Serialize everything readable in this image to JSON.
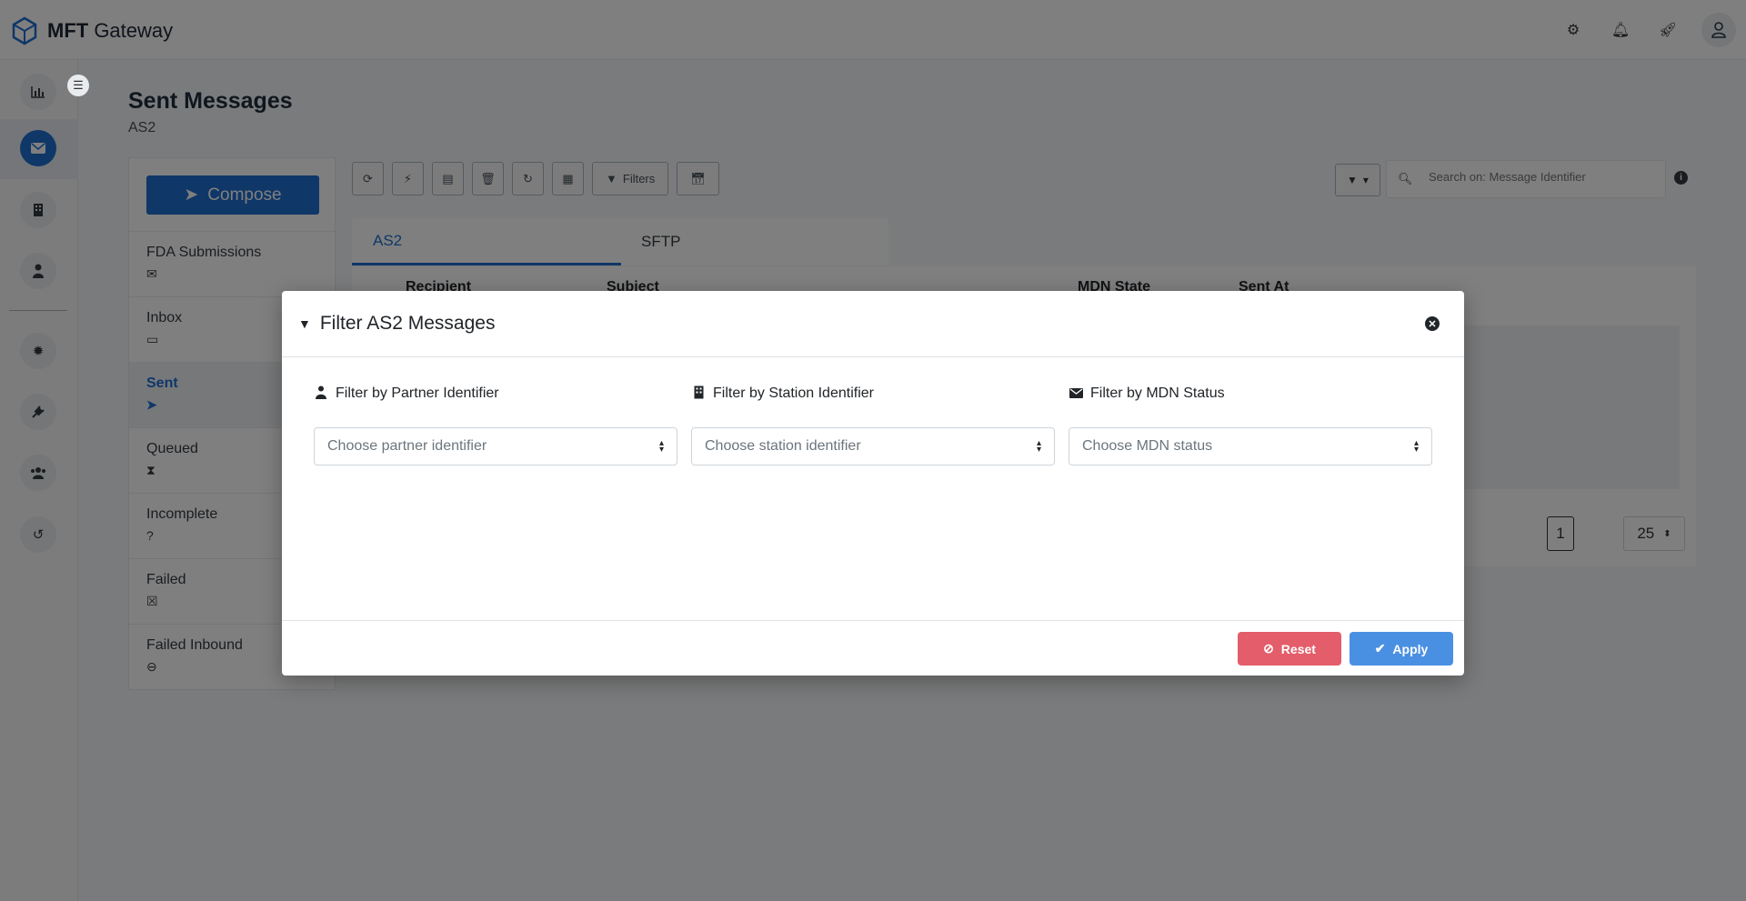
{
  "header": {
    "logo_bold": "MFT",
    "logo_rest": " Gateway",
    "icons": [
      "gear-icon",
      "bell-icon",
      "rocket-icon",
      "user-icon"
    ]
  },
  "rail": {
    "icons": [
      "chart-icon",
      "envelope-icon",
      "building-icon",
      "user-tie-icon",
      "gear-badge-icon",
      "plug-icon",
      "users-icon",
      "history-icon"
    ],
    "active": "envelope-icon"
  },
  "page": {
    "title": "Sent Messages",
    "subtitle": "AS2"
  },
  "folders": {
    "compose_label": "Compose",
    "items": [
      {
        "label": "FDA Submissions",
        "icon": "envelope-open-icon",
        "glyph": "✉"
      },
      {
        "label": "Inbox",
        "icon": "inbox-icon",
        "glyph": "▭"
      },
      {
        "label": "Sent",
        "icon": "paper-plane-icon",
        "glyph": "➤",
        "active": true
      },
      {
        "label": "Queued",
        "icon": "hourglass-icon",
        "glyph": "⧗"
      },
      {
        "label": "Incomplete",
        "icon": "question-circle-icon",
        "glyph": "?"
      },
      {
        "label": "Failed",
        "icon": "x-square-icon",
        "glyph": "☒"
      },
      {
        "label": "Failed Inbound",
        "icon": "arrow-circle-icon",
        "glyph": "⊖"
      }
    ]
  },
  "toolbar": {
    "filters_label": "Filters",
    "search_placeholder": "Search on: Message Identifier"
  },
  "tabs": [
    "AS2",
    "SFTP"
  ],
  "table": {
    "columns": [
      "Recipient",
      "Subject",
      "MDN State",
      "Sent At"
    ],
    "page": "1",
    "page_size": "25"
  },
  "modal": {
    "title": "Filter AS2 Messages",
    "filters": [
      {
        "label": "Filter by Partner Identifier",
        "placeholder": "Choose partner identifier",
        "icon": "user-tie-icon"
      },
      {
        "label": "Filter by Station Identifier",
        "placeholder": "Choose station identifier",
        "icon": "building-icon"
      },
      {
        "label": "Filter by MDN Status",
        "placeholder": "Choose MDN status",
        "icon": "envelope-icon"
      }
    ],
    "reset_label": "Reset",
    "apply_label": "Apply"
  },
  "colors": {
    "primary": "#1f6fd1",
    "reset": "#e35d6a",
    "apply": "#4a90e2"
  }
}
